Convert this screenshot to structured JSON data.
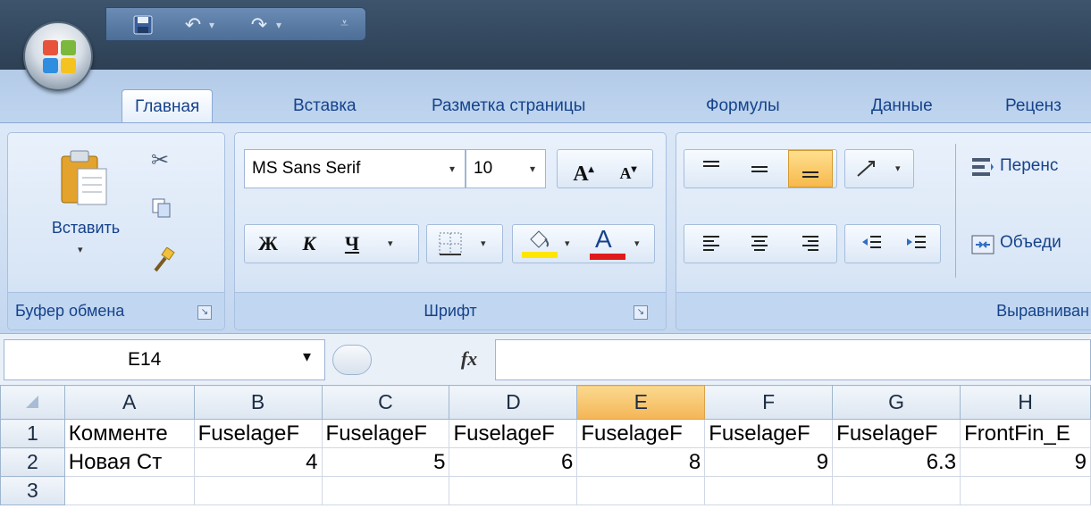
{
  "tabs": [
    "Главная",
    "Вставка",
    "Разметка страницы",
    "Формулы",
    "Данные",
    "Реценз"
  ],
  "clipboard": {
    "paste_label": "Вставить",
    "group_label": "Буфер обмена"
  },
  "font": {
    "name": "MS Sans Serif",
    "size": "10",
    "grow": "A",
    "shrink": "A",
    "bold": "Ж",
    "italic": "К",
    "underline": "Ч",
    "color_letter": "A",
    "group_label": "Шрифт"
  },
  "alignment": {
    "wrap_label": "Перенс",
    "merge_label": "Объеди",
    "group_label": "Выравниван"
  },
  "formula_bar": {
    "cell_ref": "E14",
    "fx": "fx",
    "formula": ""
  },
  "sheet": {
    "columns": [
      "A",
      "B",
      "C",
      "D",
      "E",
      "F",
      "G",
      "H"
    ],
    "selected_column": "E",
    "rows": [
      {
        "num": "1",
        "cells": [
          "Комменте",
          "FuselageF",
          "FuselageF",
          "FuselageF",
          "FuselageF",
          "FuselageF",
          "FuselageF",
          "FrontFin_E"
        ]
      },
      {
        "num": "2",
        "cells": [
          "Новая Ст",
          "4",
          "5",
          "6",
          "8",
          "9",
          "6.3",
          "9"
        ]
      },
      {
        "num": "3",
        "cells": [
          "",
          "",
          "",
          "",
          "",
          "",
          "",
          ""
        ]
      }
    ]
  },
  "colors": {
    "ribbon": "#cfdff3",
    "accent": "#15428b",
    "selection": "#f4b556",
    "highlight_yellow": "#ffe600",
    "font_red": "#e01b1b"
  }
}
